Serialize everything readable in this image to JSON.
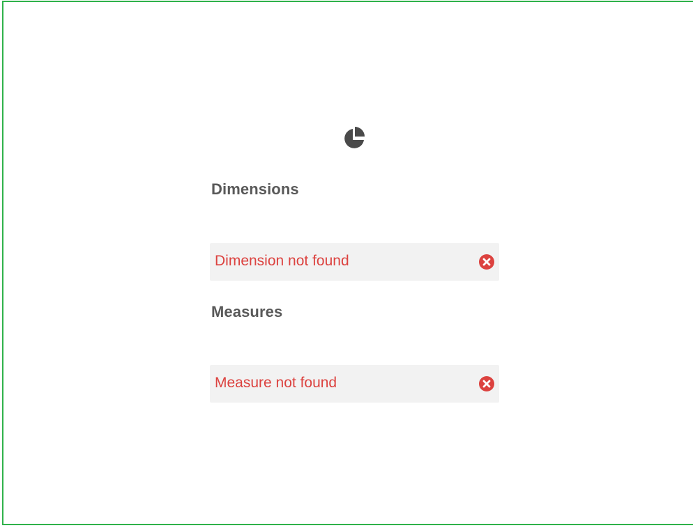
{
  "colors": {
    "frame_border": "#2fb24a",
    "heading_text": "#595959",
    "error_text": "#dc423f",
    "error_icon": "#dc423f",
    "row_background": "#f2f2f2",
    "chart_icon": "#4a4a4a"
  },
  "chart_icon": "pie-chart-icon",
  "dimensions": {
    "heading": "Dimensions",
    "items": [
      {
        "label": "Dimension not found",
        "status_icon": "error-circle-x-icon"
      }
    ]
  },
  "measures": {
    "heading": "Measures",
    "items": [
      {
        "label": "Measure not found",
        "status_icon": "error-circle-x-icon"
      }
    ]
  }
}
